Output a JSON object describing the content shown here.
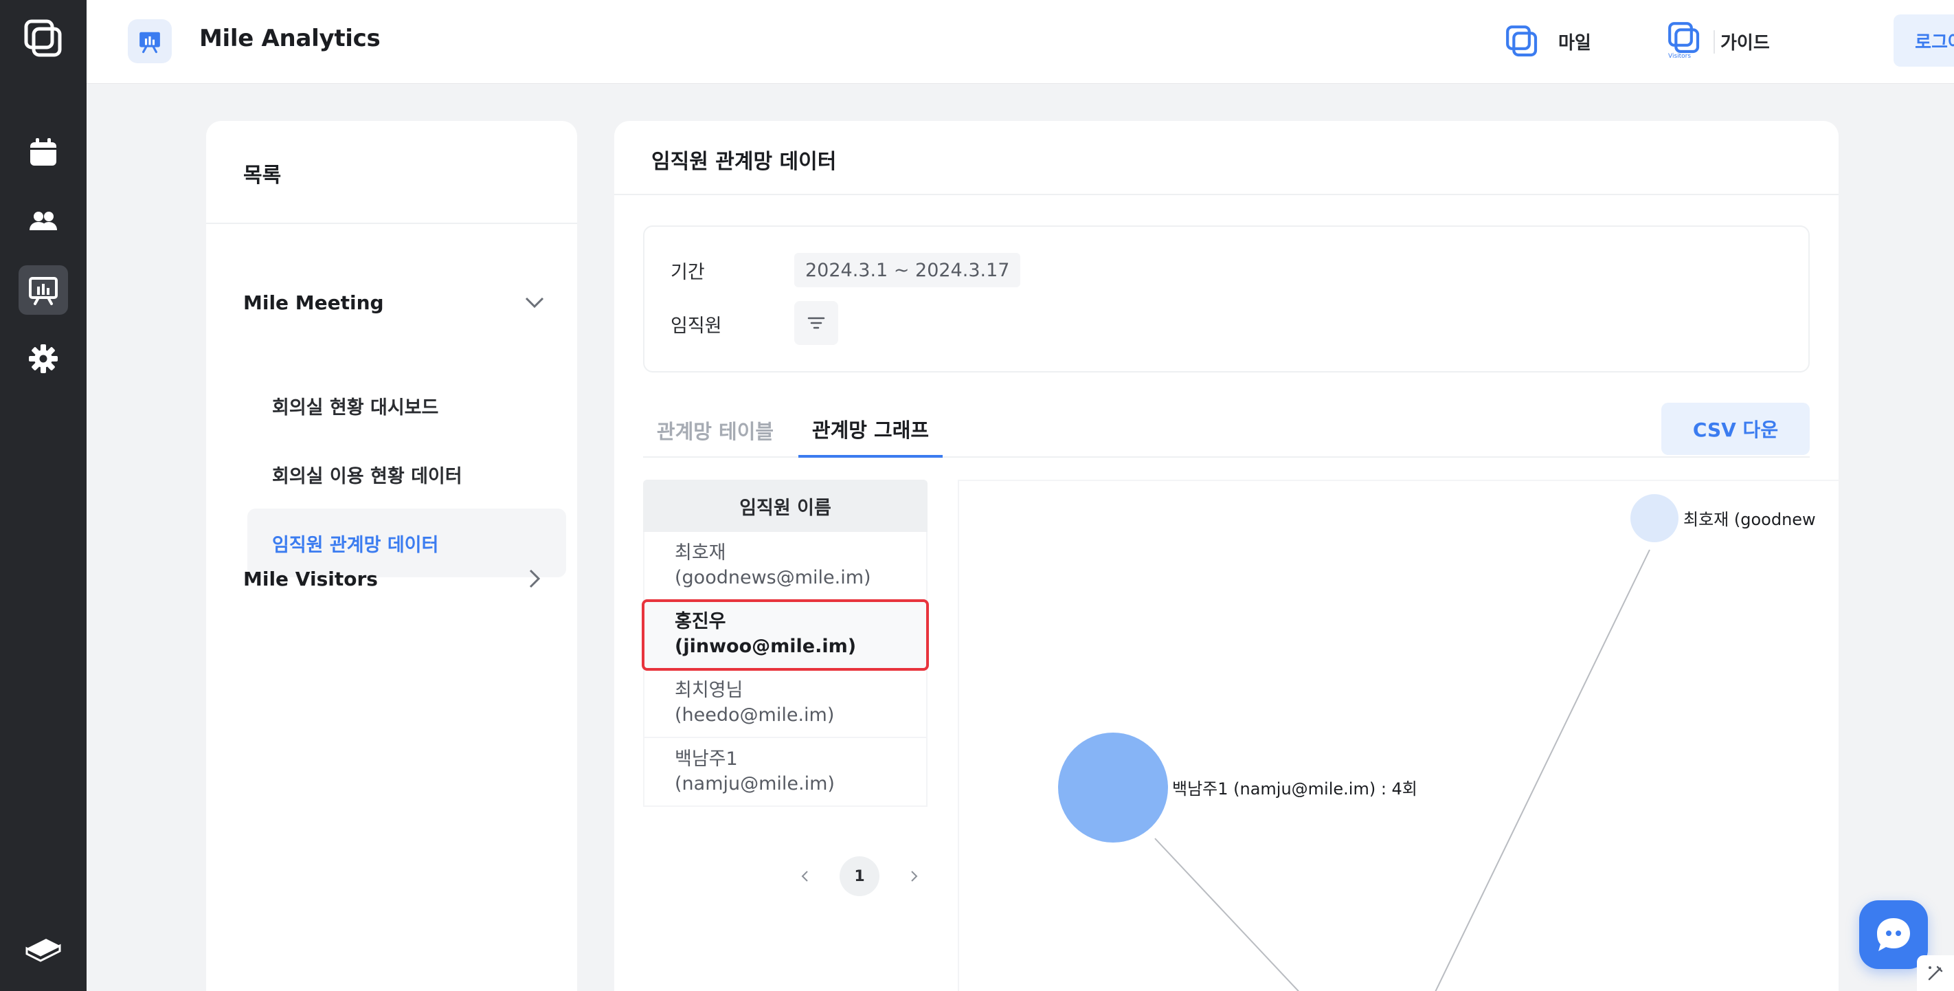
{
  "header": {
    "app_title": "Mile Analytics",
    "mile_label": "마일",
    "guide_label": "가이드",
    "logout_label": "로그아웃",
    "visitors_badge_text": "Visitors"
  },
  "rail": {
    "items": [
      {
        "icon": "calendar-icon"
      },
      {
        "icon": "users-icon"
      },
      {
        "icon": "analytics-icon",
        "active": true
      },
      {
        "icon": "gear-icon"
      }
    ],
    "bottom_icon": "book-icon"
  },
  "sidebar": {
    "title": "목록",
    "groups": [
      {
        "label": "Mile Meeting",
        "expanded": true,
        "items": [
          {
            "label": "회의실 현황 대시보드"
          },
          {
            "label": "회의실 이용 현황 데이터"
          },
          {
            "label": "임직원 관계망 데이터",
            "active": true
          }
        ]
      },
      {
        "label": "Mile Visitors",
        "expanded": false
      }
    ]
  },
  "main": {
    "title": "임직원 관계망 데이터",
    "filters": {
      "period_label": "기간",
      "period_value": "2024.3.1 ~ 2024.3.17",
      "employee_label": "임직원"
    },
    "tabs": [
      {
        "label": "관계망 테이블",
        "active": false
      },
      {
        "label": "관계망 그래프",
        "active": true
      }
    ],
    "csv_button": "CSV 다운",
    "employee_table": {
      "header": "임직원 이름",
      "rows": [
        {
          "name": "최호재 (goodnews@mile.im)"
        },
        {
          "name": "홍진우 (jinwoo@mile.im)",
          "selected": true
        },
        {
          "name": "최치영님 (heedo@mile.im)"
        },
        {
          "name": "백남주1 (namju@mile.im)"
        }
      ]
    },
    "pagination": {
      "current": "1"
    },
    "graph": {
      "nodes": [
        {
          "label": "최호재 (goodnew",
          "color": "#dde9fb"
        },
        {
          "label": "백남주1 (namju@mile.im) : 4회",
          "color": "#86b4f6"
        }
      ],
      "edge_color": "#b9bcc1"
    }
  },
  "colors": {
    "accent": "#3b7cf0",
    "rail_bg": "#26282c",
    "selection_outline": "#e8343d"
  }
}
